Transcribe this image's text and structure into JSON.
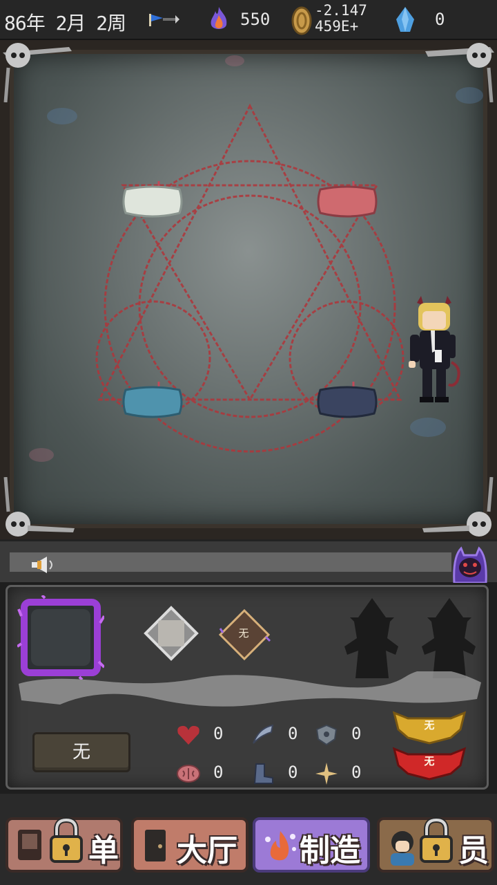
{
  "topbar": {
    "date": "86年 2月 2周",
    "fire_value": "550",
    "gold_line1": "-2.147",
    "gold_line2": "459E+",
    "gem_value": "0"
  },
  "panel": {
    "slot_label": "无",
    "name_button": "无",
    "stats": {
      "heart": "0",
      "claw": "0",
      "shield": "0",
      "brain": "0",
      "boot": "0",
      "sparkle": "0"
    },
    "badge_gold": "无",
    "badge_red": "无"
  },
  "nav": {
    "tab1_label": "单",
    "tab2_label": "大厅",
    "tab3_label": "制造",
    "tab4_label": "员"
  },
  "colors": {
    "pillow_top_left": "#dfe5dc",
    "pillow_top_right": "#cf6a6f",
    "pillow_bottom_left": "#4f93ad",
    "pillow_bottom_right": "#3a4460",
    "magic_circle": "#b0353a",
    "nav_active": "#9c7ad6"
  },
  "icons": {
    "flag": "flag-icon",
    "fire": "fire-icon",
    "coin": "coin-icon",
    "gem": "gem-icon",
    "megaphone": "megaphone-icon",
    "lock": "lock-icon"
  }
}
